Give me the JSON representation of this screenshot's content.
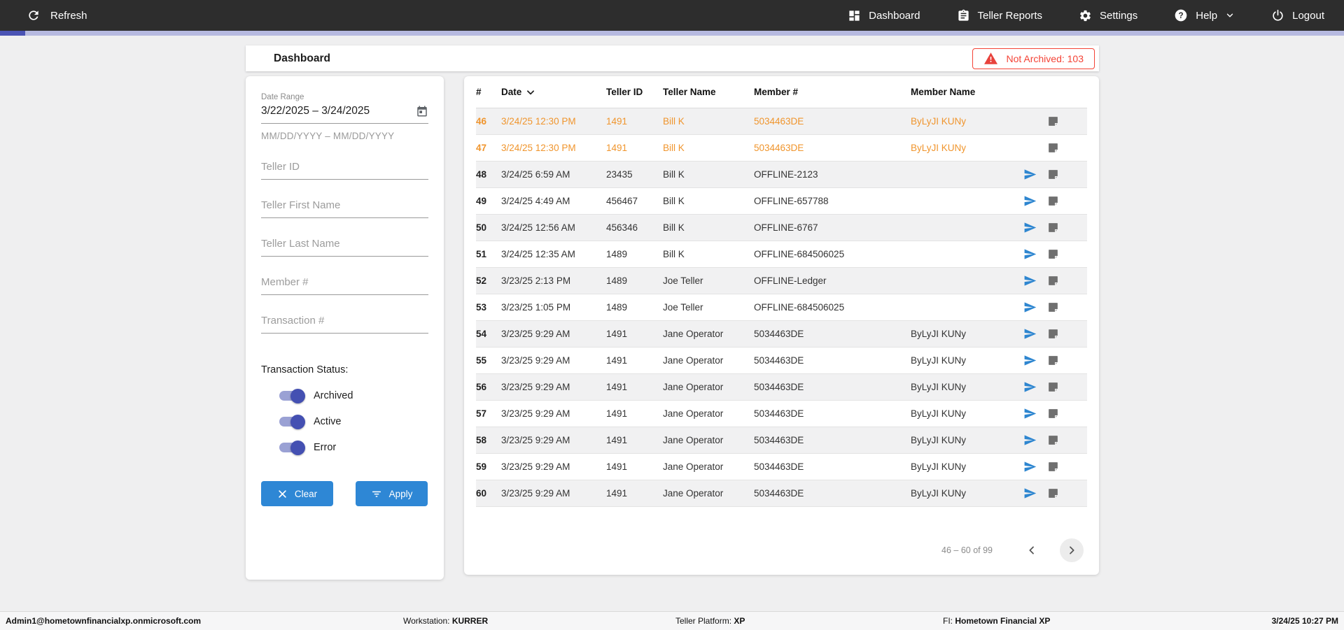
{
  "topnav": {
    "refresh_label": "Refresh",
    "items": [
      {
        "label": "Dashboard",
        "icon": "dashboard-icon"
      },
      {
        "label": "Teller Reports",
        "icon": "clipboard-icon"
      },
      {
        "label": "Settings",
        "icon": "gear-icon"
      },
      {
        "label": "Help",
        "icon": "help-icon"
      },
      {
        "label": "Logout",
        "icon": "power-icon"
      }
    ]
  },
  "header": {
    "title": "Dashboard",
    "alert_badge": "Not Archived: 103"
  },
  "filters": {
    "date_range_label": "Date Range",
    "date_range_value": "3/22/2025 – 3/24/2025",
    "date_range_hint": "MM/DD/YYYY – MM/DD/YYYY",
    "fields": [
      "Teller ID",
      "Teller First Name",
      "Teller Last Name",
      "Member #",
      "Transaction #"
    ],
    "status_label": "Transaction Status:",
    "toggles": [
      {
        "label": "Archived",
        "on": true
      },
      {
        "label": "Active",
        "on": true
      },
      {
        "label": "Error",
        "on": true
      }
    ],
    "clear_label": "Clear",
    "apply_label": "Apply"
  },
  "table": {
    "columns": [
      "#",
      "Date",
      "Teller ID",
      "Teller Name",
      "Member #",
      "Member Name"
    ],
    "sorted_column": "Date",
    "rows": [
      {
        "num": "46",
        "date": "3/24/25 12:30 PM",
        "teller_id": "1491",
        "teller_name": "Bill K",
        "member": "5034463DE",
        "member_name": "ByLyJI KUNy",
        "state": "error",
        "send": false
      },
      {
        "num": "47",
        "date": "3/24/25 12:30 PM",
        "teller_id": "1491",
        "teller_name": "Bill K",
        "member": "5034463DE",
        "member_name": "ByLyJI KUNy",
        "state": "error",
        "send": false
      },
      {
        "num": "48",
        "date": "3/24/25 6:59 AM",
        "teller_id": "23435",
        "teller_name": "Bill K",
        "member": "OFFLINE-2123",
        "member_name": "",
        "state": "normal",
        "send": true
      },
      {
        "num": "49",
        "date": "3/24/25 4:49 AM",
        "teller_id": "456467",
        "teller_name": "Bill K",
        "member": "OFFLINE-657788",
        "member_name": "",
        "state": "normal",
        "send": true
      },
      {
        "num": "50",
        "date": "3/24/25 12:56 AM",
        "teller_id": "456346",
        "teller_name": "Bill K",
        "member": "OFFLINE-6767",
        "member_name": "",
        "state": "normal",
        "send": true
      },
      {
        "num": "51",
        "date": "3/24/25 12:35 AM",
        "teller_id": "1489",
        "teller_name": "Bill K",
        "member": "OFFLINE-684506025",
        "member_name": "",
        "state": "normal",
        "send": true
      },
      {
        "num": "52",
        "date": "3/23/25 2:13 PM",
        "teller_id": "1489",
        "teller_name": "Joe Teller",
        "member": "OFFLINE-Ledger",
        "member_name": "",
        "state": "normal",
        "send": true
      },
      {
        "num": "53",
        "date": "3/23/25 1:05 PM",
        "teller_id": "1489",
        "teller_name": "Joe Teller",
        "member": "OFFLINE-684506025",
        "member_name": "",
        "state": "normal",
        "send": true
      },
      {
        "num": "54",
        "date": "3/23/25 9:29 AM",
        "teller_id": "1491",
        "teller_name": "Jane Operator",
        "member": "5034463DE",
        "member_name": "ByLyJI KUNy",
        "state": "normal",
        "send": true
      },
      {
        "num": "55",
        "date": "3/23/25 9:29 AM",
        "teller_id": "1491",
        "teller_name": "Jane Operator",
        "member": "5034463DE",
        "member_name": "ByLyJI KUNy",
        "state": "normal",
        "send": true
      },
      {
        "num": "56",
        "date": "3/23/25 9:29 AM",
        "teller_id": "1491",
        "teller_name": "Jane Operator",
        "member": "5034463DE",
        "member_name": "ByLyJI KUNy",
        "state": "normal",
        "send": true
      },
      {
        "num": "57",
        "date": "3/23/25 9:29 AM",
        "teller_id": "1491",
        "teller_name": "Jane Operator",
        "member": "5034463DE",
        "member_name": "ByLyJI KUNy",
        "state": "normal",
        "send": true
      },
      {
        "num": "58",
        "date": "3/23/25 9:29 AM",
        "teller_id": "1491",
        "teller_name": "Jane Operator",
        "member": "5034463DE",
        "member_name": "ByLyJI KUNy",
        "state": "normal",
        "send": true
      },
      {
        "num": "59",
        "date": "3/23/25 9:29 AM",
        "teller_id": "1491",
        "teller_name": "Jane Operator",
        "member": "5034463DE",
        "member_name": "ByLyJI KUNy",
        "state": "normal",
        "send": true
      },
      {
        "num": "60",
        "date": "3/23/25 9:29 AM",
        "teller_id": "1491",
        "teller_name": "Jane Operator",
        "member": "5034463DE",
        "member_name": "ByLyJI KUNy",
        "state": "normal",
        "send": true
      }
    ],
    "row_icons": [
      "send-icon",
      "note-icon"
    ],
    "pagination": {
      "range_label": "46 – 60 of 99"
    }
  },
  "footer": {
    "user": "Admin1@hometownfinancialxp.onmicrosoft.com",
    "workstation_label": "Workstation: ",
    "workstation_value": "KURRER",
    "platform_label": "Teller Platform: ",
    "platform_value": "XP",
    "fi_label": "FI: ",
    "fi_value": "Hometown Financial XP",
    "datetime": "3/24/25 10:27 PM"
  },
  "colors": {
    "navbar_bg": "#2d2d2d",
    "progress_track": "#b6b9e0",
    "progress_fill": "#4a53b4",
    "accent_blue": "#2e87d5",
    "error_orange": "#f0952d",
    "alert_red": "#f44336",
    "toggle_thumb": "#4450b2",
    "toggle_track": "#9aa1d4",
    "row_stripe": "#f1f1f2"
  }
}
